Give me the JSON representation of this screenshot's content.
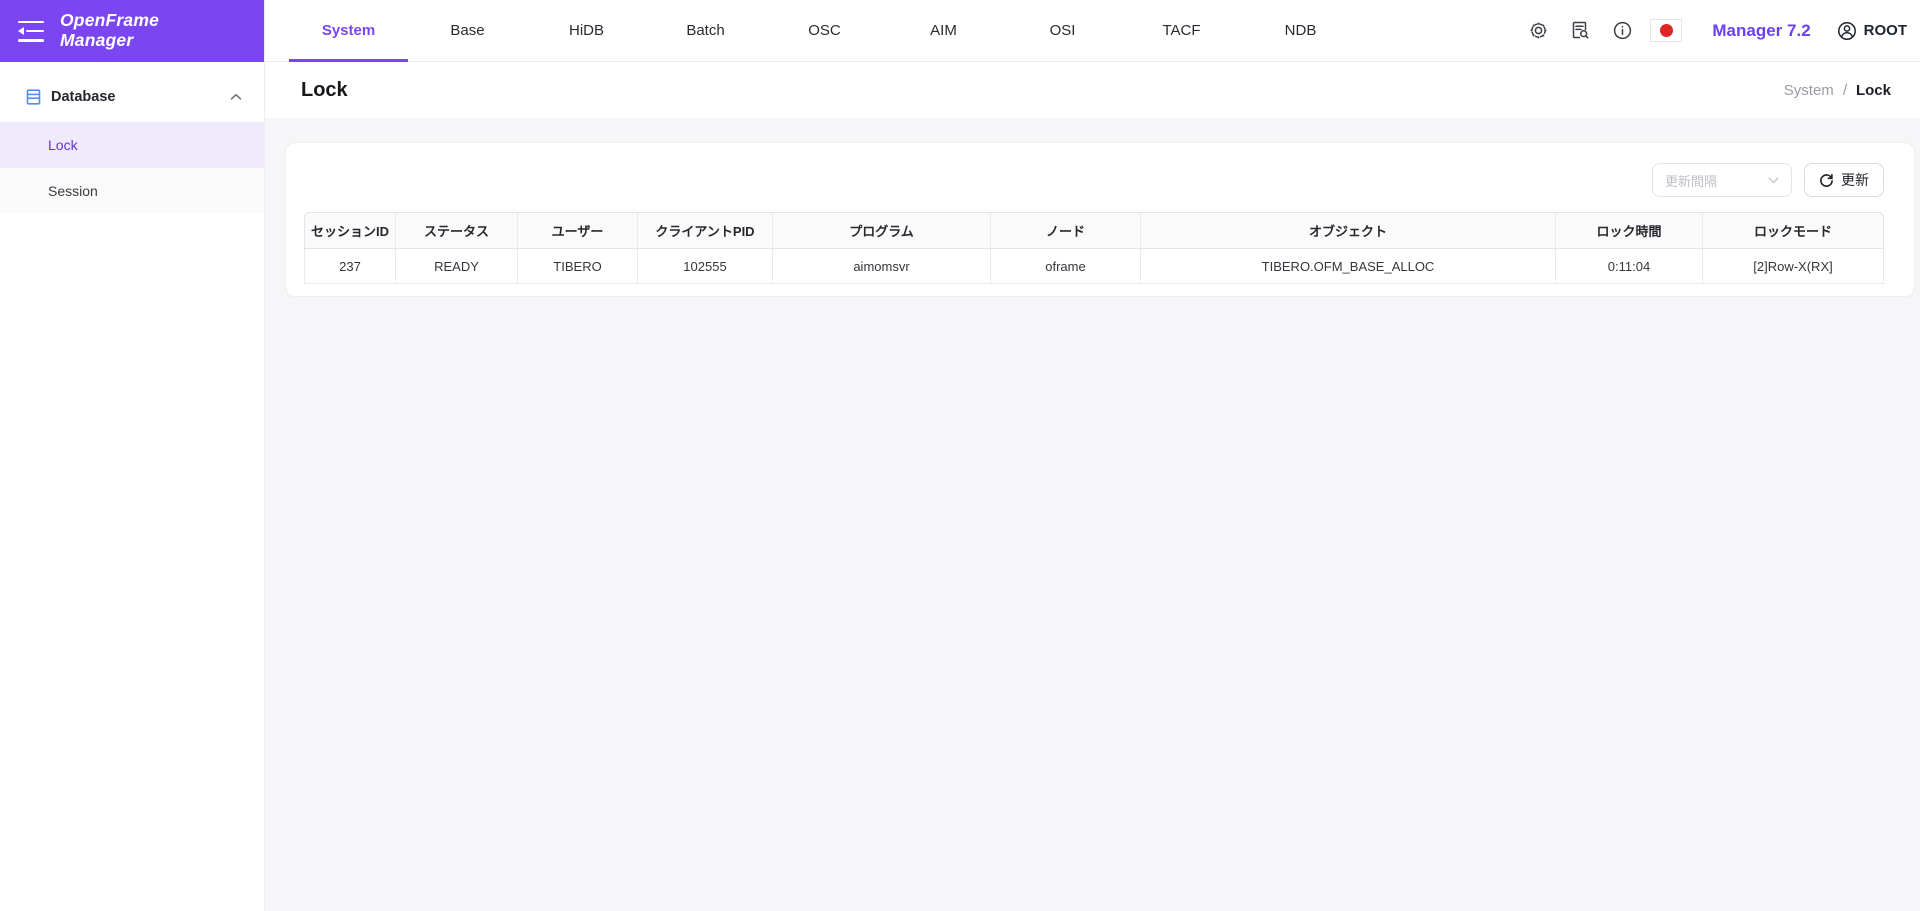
{
  "colors": {
    "accent": "#7B46F2",
    "accent_light_bg": "#EFEBFC",
    "sidebar_active_text": "#6B2FD6",
    "flag_red": "#E02525",
    "content_bg": "#F6F6F8"
  },
  "brand": {
    "line1": "OpenFrame",
    "line2": "Manager"
  },
  "sidebar": {
    "section": {
      "label": "Database"
    },
    "items": [
      {
        "label": "Lock",
        "active": true
      },
      {
        "label": "Session",
        "active": false
      }
    ]
  },
  "topnav": {
    "tabs": [
      {
        "label": "System"
      },
      {
        "label": "Base"
      },
      {
        "label": "HiDB"
      },
      {
        "label": "Batch"
      },
      {
        "label": "OSC"
      },
      {
        "label": "AIM"
      },
      {
        "label": "OSI"
      },
      {
        "label": "TACF"
      },
      {
        "label": "NDB"
      }
    ],
    "active_tab": "System",
    "version": "Manager 7.2",
    "user": "ROOT"
  },
  "icons": {
    "collapse_menu": "sidebar-collapse-icon",
    "database": "database-icon",
    "chevron_up": "chevron-up-icon",
    "settings": "gear-icon",
    "doc_search": "document-search-icon",
    "info": "info-icon",
    "language_flag": "japan-flag-icon",
    "user": "user-icon",
    "refresh": "refresh-icon",
    "chevron_down": "chevron-down-icon"
  },
  "page": {
    "title": "Lock",
    "breadcrumb_parent": "System",
    "breadcrumb_separator": "/",
    "breadcrumb_current": "Lock"
  },
  "controls": {
    "interval_placeholder": "更新間隔",
    "refresh_label": "更新"
  },
  "table": {
    "headers": [
      "セッションID",
      "ステータス",
      "ユーザー",
      "クライアントPID",
      "プログラム",
      "ノード",
      "オブジェクト",
      "ロック時間",
      "ロックモード"
    ],
    "rows": [
      [
        "237",
        "READY",
        "TIBERO",
        "102555",
        "aimomsvr",
        "oframe",
        "TIBERO.OFM_BASE_ALLOC",
        "0:11:04",
        "[2]Row-X(RX]"
      ]
    ]
  }
}
